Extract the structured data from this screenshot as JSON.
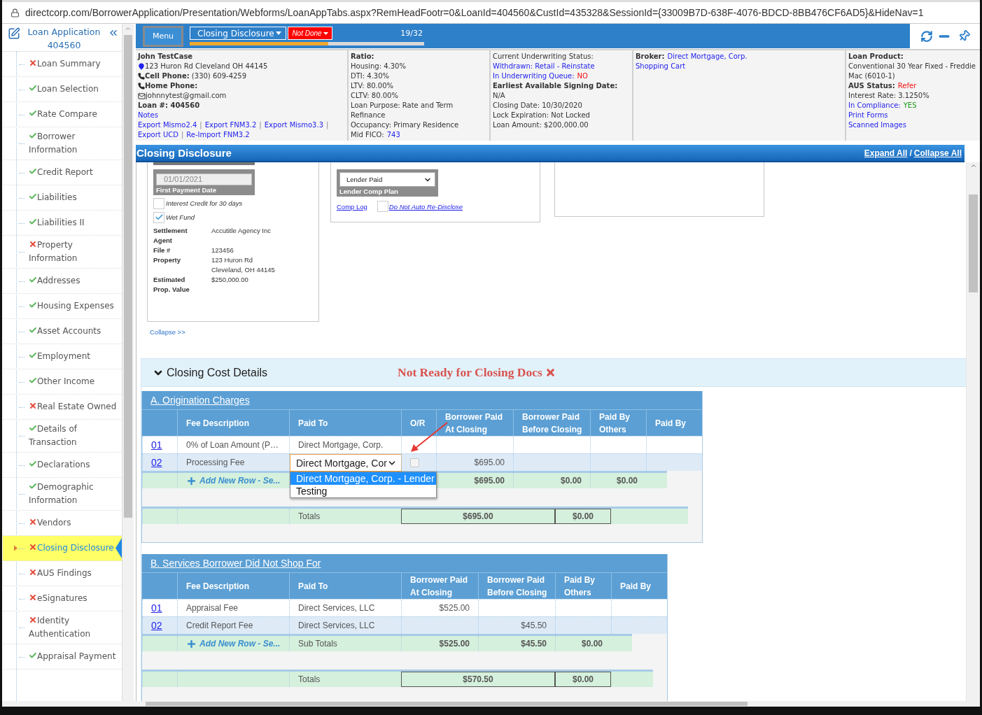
{
  "address_bar": {
    "url": "directcorp.com/BorrowerApplication/Presentation/Webforms/LoanAppTabs.aspx?RemHeadFootr=0&LoanId=404560&CustId=435328&SessionId={33009B7D-638F-4076-BDCD-8BB476CF6AD5}&HideNav=1"
  },
  "sidebar": {
    "title": "Loan Application",
    "loan_number": "404560",
    "items": [
      {
        "label": "Loan Summary",
        "done": false,
        "selected": false
      },
      {
        "label": "Loan Selection",
        "done": true,
        "selected": false
      },
      {
        "label": "Rate Compare",
        "done": true,
        "selected": false
      },
      {
        "label": "Borrower Information",
        "done": true,
        "selected": false
      },
      {
        "label": "Credit Report",
        "done": true,
        "selected": false
      },
      {
        "label": "Liabilities",
        "done": true,
        "selected": false
      },
      {
        "label": "Liabilities II",
        "done": true,
        "selected": false
      },
      {
        "label": "Property Information",
        "done": false,
        "selected": false
      },
      {
        "label": "Addresses",
        "done": true,
        "selected": false
      },
      {
        "label": "Housing Expenses",
        "done": true,
        "selected": false
      },
      {
        "label": "Asset Accounts",
        "done": true,
        "selected": false
      },
      {
        "label": "Employment",
        "done": true,
        "selected": false
      },
      {
        "label": "Other Income",
        "done": true,
        "selected": false
      },
      {
        "label": "Real Estate Owned",
        "done": false,
        "selected": false
      },
      {
        "label": "Details of Transaction",
        "done": true,
        "selected": false
      },
      {
        "label": "Declarations",
        "done": true,
        "selected": false
      },
      {
        "label": "Demographic Information",
        "done": true,
        "selected": false
      },
      {
        "label": "Vendors",
        "done": false,
        "selected": false
      },
      {
        "label": "Closing Disclosure",
        "done": false,
        "selected": true
      },
      {
        "label": "AUS Findings",
        "done": false,
        "selected": false
      },
      {
        "label": "eSignatures",
        "done": false,
        "selected": false
      },
      {
        "label": "Identity Authentication",
        "done": false,
        "selected": false
      },
      {
        "label": "Appraisal Payment",
        "done": true,
        "selected": false
      }
    ]
  },
  "header": {
    "menu": "Menu",
    "step": "Closing Disclosure",
    "status": "Not Done",
    "progress": {
      "level": 0.59
    },
    "step_count": "19/32"
  },
  "info_panels": [
    {
      "lines": [
        {
          "parts": [
            {
              "text": "John TestCase",
              "kind": "label"
            }
          ]
        },
        {
          "kind": "address",
          "parts": [
            {
              "text": "123 Huron Rd Cleveland OH 44145",
              "kind": "text"
            }
          ]
        },
        {
          "kind": "phone",
          "parts": [
            {
              "text": "**Cell Phone:** (330) 609-4259",
              "kind": "text"
            }
          ]
        },
        {
          "kind": "phone",
          "parts": [
            {
              "text": "Home Phone:",
              "kind": "label"
            }
          ]
        },
        {
          "kind": "email",
          "parts": [
            {
              "text": "johnnytest@gmail.com",
              "kind": "text"
            }
          ]
        },
        {
          "parts": [
            {
              "text": "Loan #: 404560",
              "kind": "label"
            }
          ]
        },
        {
          "parts": [
            {
              "text": "Notes",
              "kind": "link"
            }
          ]
        },
        {
          "parts": [
            {
              "text": "Export Mismo2.4",
              "kind": "link"
            },
            {
              "text": "|",
              "kind": "sep"
            },
            {
              "text": "Export FNM3.2",
              "kind": "link"
            },
            {
              "text": "|",
              "kind": "sep"
            },
            {
              "text": "Export Mismo3.3",
              "kind": "link"
            },
            {
              "text": "|",
              "kind": "sep"
            },
            {
              "text": "Export UCD",
              "kind": "link"
            },
            {
              "text": "|",
              "kind": "sep"
            },
            {
              "text": "Re-Import FNM3.2",
              "kind": "link"
            }
          ]
        }
      ]
    },
    {
      "lines": [
        {
          "parts": [
            {
              "text": "Ratio:",
              "kind": "label"
            }
          ]
        },
        {
          "parts": [
            {
              "text": "Housing: 4.30%",
              "kind": "text"
            }
          ]
        },
        {
          "parts": [
            {
              "text": "DTI: 4.30%",
              "kind": "text"
            }
          ]
        },
        {
          "parts": [
            {
              "text": "LTV: 80.00%",
              "kind": "text"
            }
          ]
        },
        {
          "parts": [
            {
              "text": "CLTV: 80.00%",
              "kind": "text"
            }
          ]
        },
        {
          "parts": [
            {
              "text": "Loan Purpose: Rate and Term Refinance",
              "kind": "text"
            }
          ]
        },
        {
          "parts": [
            {
              "text": "Occupancy: Primary Residence",
              "kind": "text"
            }
          ]
        },
        {
          "parts": [
            {
              "text": "Mid FICO:",
              "kind": "text"
            },
            {
              "text": "743",
              "kind": "link"
            }
          ]
        }
      ]
    },
    {
      "lines": [
        {
          "parts": [
            {
              "text": "Current Underwriting Status:",
              "kind": "text"
            }
          ]
        },
        {
          "parts": [
            {
              "text": "Withdrawn: Retail - Reinstate",
              "kind": "link"
            }
          ]
        },
        {
          "parts": [
            {
              "text": "In Underwriting Queue:",
              "kind": "link"
            },
            {
              "text": "NO",
              "kind": "alert"
            }
          ]
        },
        {
          "parts": [
            {
              "text": "**Earliest Available Signing Date:** N/A",
              "kind": "text"
            }
          ]
        },
        {
          "parts": [
            {
              "text": "Closing Date: 10/30/2020",
              "kind": "text"
            }
          ]
        },
        {
          "parts": [
            {
              "text": "Lock Expiration: Not Locked",
              "kind": "text"
            }
          ]
        },
        {
          "parts": [
            {
              "text": "Loan Amount: $200,000.00",
              "kind": "text"
            }
          ]
        }
      ]
    },
    {
      "lines": [
        {
          "parts": [
            {
              "text": "Broker:",
              "kind": "label"
            },
            {
              "text": "Direct Mortgage, Corp.",
              "kind": "link"
            }
          ]
        },
        {
          "parts": [
            {
              "text": "Shopping Cart",
              "kind": "link"
            }
          ]
        }
      ]
    },
    {
      "lines": [
        {
          "parts": [
            {
              "text": "Loan Product:",
              "kind": "label"
            }
          ]
        },
        {
          "parts": [
            {
              "text": "Conventional 30 Year Fixed - Freddie Mac (6010-1)",
              "kind": "text"
            }
          ]
        },
        {
          "parts": [
            {
              "text": "AUS Status:",
              "kind": "label"
            },
            {
              "text": "Refer",
              "kind": "alert"
            }
          ]
        },
        {
          "parts": [
            {
              "text": "Interest Rate: 3.1250%",
              "kind": "text"
            }
          ]
        },
        {
          "parts": [
            {
              "text": "In Compliance:",
              "kind": "link"
            },
            {
              "text": "YES",
              "kind": "ok"
            }
          ]
        },
        {
          "parts": [
            {
              "text": "Print Forms",
              "kind": "link"
            }
          ]
        },
        {
          "parts": [
            {
              "text": "Scanned Images",
              "kind": "link"
            }
          ]
        }
      ]
    }
  ],
  "section": {
    "title": "Closing Disclosure",
    "expand": "Expand All",
    "divider": "/",
    "collapse": "Collapse All"
  },
  "loan_card": {
    "date_field": {
      "value": "01/01/2021",
      "label": "First Payment Date"
    },
    "checkboxes": [
      {
        "label": "Interest Credit for 30 days",
        "checked": false
      },
      {
        "label": "Wet Fund",
        "checked": true
      }
    ],
    "details": [
      {
        "label": "Settlement Agent",
        "values": [
          "Accutitle Agency Inc"
        ]
      },
      {
        "label": "File #",
        "values": [
          "123456"
        ]
      },
      {
        "label": "Property",
        "values": [
          "123 Huron Rd",
          "Cleveland, OH 44145"
        ]
      },
      {
        "label": "Estimated Prop. Value",
        "values": [
          "$250,000.00"
        ]
      }
    ],
    "collapse_link": "Collapse >>"
  },
  "comp_card": {
    "select": {
      "value": "Lender Paid",
      "label": "Lender Comp Plan"
    },
    "link": "Comp Log",
    "checkbox": {
      "label": "Do Not Auto Re-Disclose",
      "checked": false
    }
  },
  "closing_costs": {
    "title": "Closing Cost Details",
    "status": "Not Ready for Closing Docs",
    "tables": [
      {
        "title": "A. Origination Charges",
        "columns": [
          {
            "kind": "description",
            "label": "Fee Description"
          },
          {
            "kind": "paid_to",
            "label": "Paid To"
          },
          {
            "kind": "or",
            "label": "O/R"
          },
          {
            "kind": "at_closing",
            "label": "Borrower Paid At Closing"
          },
          {
            "kind": "before_closing",
            "label": "Borrower Paid Before Closing"
          },
          {
            "kind": "others",
            "label": "Paid By Others"
          },
          {
            "kind": "paid_by",
            "label": "Paid By"
          }
        ],
        "rows": [
          {
            "kind": "text",
            "number": "01",
            "description": "0% of Loan Amount (P…",
            "paid_to": "Direct Mortgage, Corp."
          },
          {
            "kind": "select",
            "number": "02",
            "description": "Processing Fee",
            "paid_to": "Direct Mortgage, Cor",
            "or_checked": false,
            "at_closing": "$695.00",
            "dropdown": [
              {
                "text": "Direct Mortgage, Corp. - Lender",
                "selected": true
              },
              {
                "text": "Testing",
                "selected": false
              }
            ]
          }
        ],
        "subtotal": {
          "add_link": "Add New Row - Se...",
          "at_closing": "$695.00",
          "before_closing": "$0.00",
          "others": "$0.00"
        },
        "totals": {
          "label": "Totals",
          "amount": "$695.00",
          "others": "$0.00"
        }
      },
      {
        "title": "B. Services Borrower Did Not Shop For",
        "columns": [
          {
            "kind": "description",
            "label": "Fee Description"
          },
          {
            "kind": "paid_to",
            "label": "Paid To"
          },
          {
            "kind": "at_closing",
            "label": "Borrower Paid At Closing"
          },
          {
            "kind": "before_closing",
            "label": "Borrower Paid Before Closing"
          },
          {
            "kind": "others",
            "label": "Paid By Others"
          },
          {
            "kind": "paid_by",
            "label": "Paid By"
          }
        ],
        "rows": [
          {
            "kind": "text",
            "number": "01",
            "description": "Appraisal Fee",
            "paid_to": "Direct Services, LLC",
            "at_closing": "$525.00"
          },
          {
            "kind": "text",
            "number": "02",
            "description": "Credit Report Fee",
            "paid_to": "Direct Services, LLC",
            "before_closing": "$45.50"
          }
        ],
        "subtotal": {
          "add_link": "Add New Row - Se...",
          "label": "Sub Totals",
          "at_closing": "$525.00",
          "before_closing": "$45.50",
          "others": "$0.00"
        },
        "totals": {
          "label": "Totals",
          "amount": "$570.50",
          "others": "$0.00"
        }
      }
    ]
  }
}
